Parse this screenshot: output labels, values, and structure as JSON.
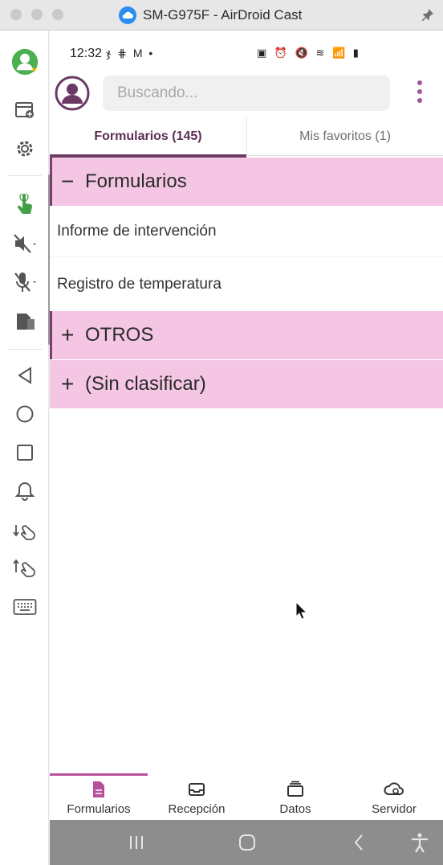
{
  "window": {
    "title": "SM-G975F - AirDroid Cast"
  },
  "toolbar": {
    "icons": [
      "user-avatar-icon",
      "new-window-icon",
      "gear-icon",
      "touch-control-icon",
      "speaker-muted-icon",
      "mic-muted-icon",
      "screen-file-icon",
      "back-icon",
      "home-icon",
      "recents-icon",
      "notification-bell-icon",
      "volume-down-icon",
      "volume-up-icon",
      "keyboard-icon"
    ]
  },
  "status_bar": {
    "time": "12:32",
    "left_icons": "ჯ ⋕ M •",
    "right_icons": "▣ ⏰ 🔇 ≋ 📶 ▮"
  },
  "app_bar": {
    "search_placeholder": "Buscando..."
  },
  "tabs": [
    {
      "label": "Formularios (145)",
      "active": true
    },
    {
      "label": "Mis favoritos (1)",
      "active": false
    }
  ],
  "list": {
    "group_formularios": {
      "symbol": "−",
      "label": "Formularios",
      "expanded": true
    },
    "items": [
      {
        "label": "Informe de intervención"
      },
      {
        "label": "Registro de temperatura"
      }
    ],
    "group_otros": {
      "symbol": "+",
      "label": "OTROS",
      "expanded": false
    },
    "group_sin": {
      "symbol": "+",
      "label": "(Sin clasificar)",
      "expanded": false
    }
  },
  "bottom_nav": [
    {
      "label": "Formularios",
      "icon": "document-icon",
      "active": true
    },
    {
      "label": "Recepción",
      "icon": "inbox-icon",
      "active": false
    },
    {
      "label": "Datos",
      "icon": "archive-icon",
      "active": false
    },
    {
      "label": "Servidor",
      "icon": "cloud-sync-icon",
      "active": false
    }
  ],
  "colors": {
    "accent": "#6b3a64",
    "group_bg": "#f5c6e4",
    "nav_active": "#b84f9b"
  }
}
